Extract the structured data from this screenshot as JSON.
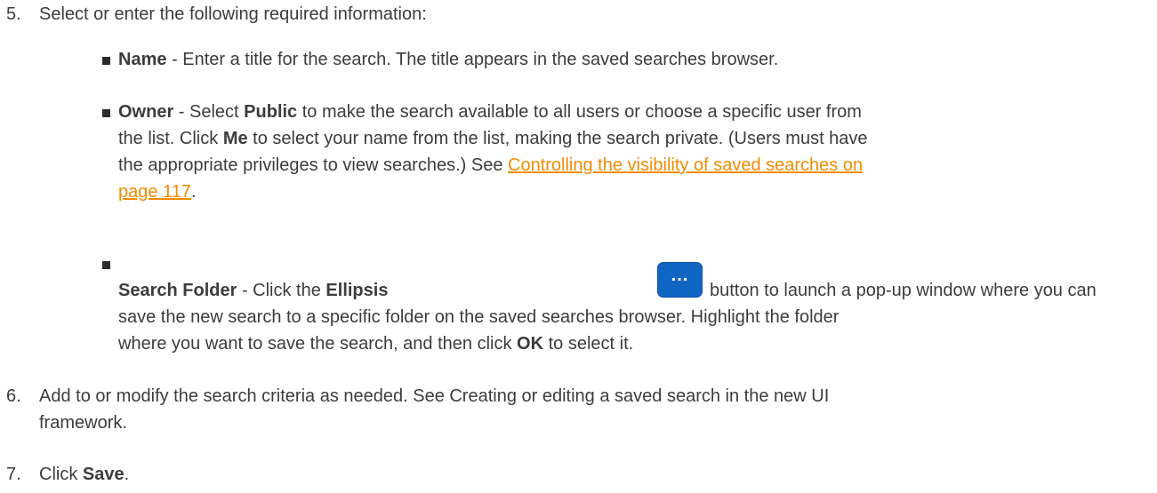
{
  "steps": {
    "step5": {
      "number": "5.",
      "text": "Select or enter the following required information:",
      "bullets": {
        "name": {
          "term": "Name",
          "text": " - Enter a title for the search. The title appears in the saved searches browser."
        },
        "owner": {
          "term": "Owner",
          "text1": " - Select ",
          "public": "Public",
          "text2": " to make the search available to all users or choose a specific user from",
          "line2a": "the list. Click ",
          "me": "Me",
          "line2b": " to select your name from the list, making the search private. (Users must have",
          "line3": "the appropriate privileges to view searches.) See ",
          "link_line1": "Controlling the visibility of saved searches on",
          "link_line2": "page 117",
          "period": "."
        },
        "folder": {
          "term": "Search Folder",
          "text1": " - Click the ",
          "ellipsis": "Ellipsis",
          "button_label": "...",
          "text2": " button to launch a pop-up window where you can",
          "line2": "save the new search to a specific folder on the saved searches browser. Highlight the folder",
          "line3a": "where you want to save the search, and then click ",
          "ok": "OK",
          "line3b": " to select it."
        }
      }
    },
    "step6": {
      "number": "6.",
      "line1": "Add to or modify the search criteria as needed. See Creating or editing a saved search in the new UI",
      "line2": "framework."
    },
    "step7": {
      "number": "7.",
      "text": "Click ",
      "save": "Save",
      "period": "."
    }
  }
}
